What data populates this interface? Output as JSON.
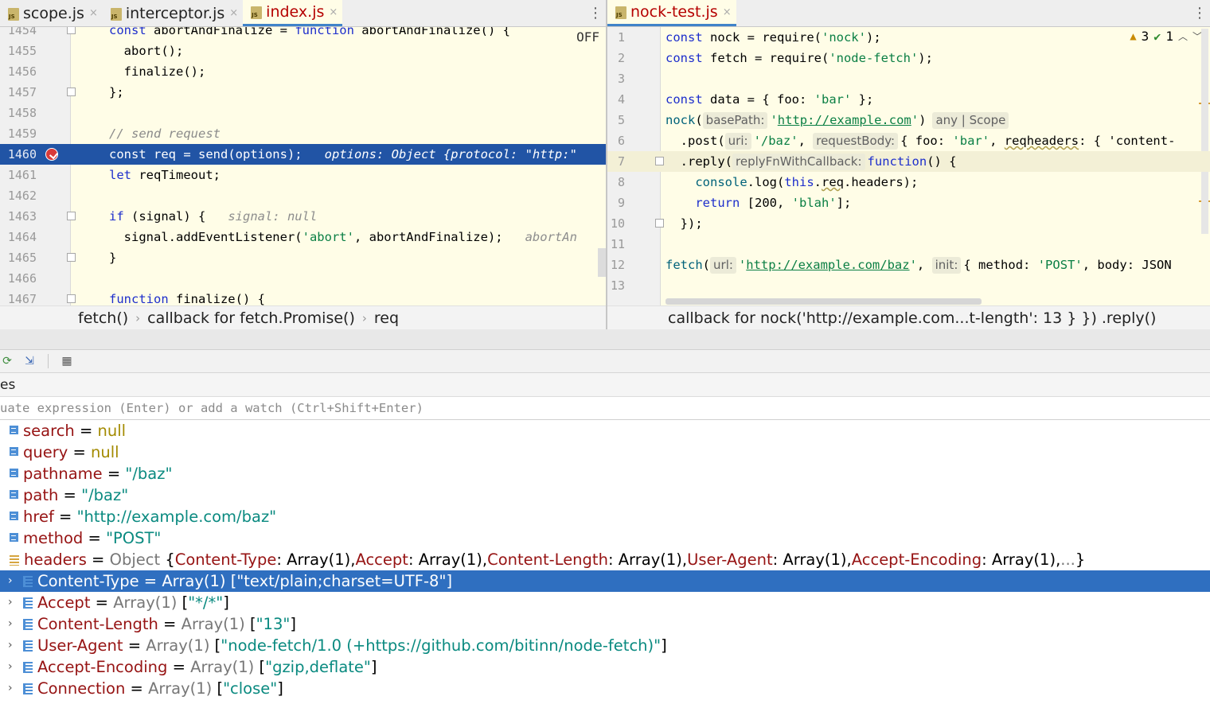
{
  "left_tabs": [
    {
      "name": "scope.js",
      "active": false
    },
    {
      "name": "interceptor.js",
      "active": false
    },
    {
      "name": "index.js",
      "active": true
    }
  ],
  "right_tabs": [
    {
      "name": "nock-test.js",
      "active": true
    }
  ],
  "more_glyph": "⋮",
  "close_glyph": "×",
  "left_editor": {
    "off_label": "OFF",
    "lines": [
      {
        "n": "1454",
        "code": "  const abortAndFinalize = function abortAndFinalize() {"
      },
      {
        "n": "1455",
        "code": "    abort();"
      },
      {
        "n": "1456",
        "code": "    finalize();"
      },
      {
        "n": "1457",
        "code": "  };"
      },
      {
        "n": "1458",
        "code": ""
      },
      {
        "n": "1459",
        "code": "  // send request"
      },
      {
        "n": "1460",
        "code": "  const req = send(options);",
        "inline": "options: Object {protocol: \"http:\"",
        "exec": true
      },
      {
        "n": "1461",
        "code": "  let reqTimeout;"
      },
      {
        "n": "1462",
        "code": ""
      },
      {
        "n": "1463",
        "code": "  if (signal) {",
        "inline": "signal: null"
      },
      {
        "n": "1464",
        "code": "    signal.addEventListener('abort', abortAndFinalize);",
        "inline": "abortAn"
      },
      {
        "n": "1465",
        "code": "  }"
      },
      {
        "n": "1466",
        "code": ""
      },
      {
        "n": "1467",
        "code": "  function finalize() {"
      }
    ]
  },
  "right_editor": {
    "inspection": {
      "warnings": "3",
      "ok": "1"
    },
    "lines": [
      {
        "n": "1",
        "code": "const nock = require('nock');"
      },
      {
        "n": "2",
        "code": "const fetch = require('node-fetch');"
      },
      {
        "n": "3",
        "code": ""
      },
      {
        "n": "4",
        "code": "const data = { foo: 'bar' };"
      },
      {
        "n": "5",
        "pre": "nock(",
        "hint1": "basePath:",
        "mid": "'http://example.com')",
        "hint2": "any | Scope"
      },
      {
        "n": "6",
        "pre": "  .post(",
        "hint1": "uri:",
        "mid": "'/baz', ",
        "hint2": "requestBody:",
        "post": "{ foo: 'bar', reqheaders: { 'content-"
      },
      {
        "n": "7",
        "pre": "  .reply(",
        "hint1": "replyFnWithCallback:",
        "mid": "function() {"
      },
      {
        "n": "8",
        "code": "    console.log(this.req.headers);"
      },
      {
        "n": "9",
        "code": "    return [200, 'blah'];"
      },
      {
        "n": "10",
        "code": "  });"
      },
      {
        "n": "11",
        "code": ""
      },
      {
        "n": "12",
        "pre": "fetch(",
        "hint1": "url:",
        "mid": "'http://example.com/baz', ",
        "hint2": "init:",
        "post": "{ method: 'POST', body: JSON"
      },
      {
        "n": "13",
        "code": ""
      }
    ]
  },
  "left_breadcrumbs": [
    "fetch()",
    "callback for fetch.Promise()",
    "req"
  ],
  "right_breadcrumbs": [
    "callback for nock('http://example.com...t-length': 13 } }) .reply()"
  ],
  "debugger": {
    "panel_title": "es",
    "eval_placeholder": "uate expression (Enter) or add a watch (Ctrl+Shift+Enter)",
    "variables": [
      {
        "name": "search",
        "eq": " = ",
        "value": "null",
        "kind": "null"
      },
      {
        "name": "query",
        "eq": " = ",
        "value": "null",
        "kind": "null"
      },
      {
        "name": "pathname",
        "eq": " = ",
        "value": "\"/baz\"",
        "kind": "str"
      },
      {
        "name": "path",
        "eq": " = ",
        "value": "\"/baz\"",
        "kind": "str"
      },
      {
        "name": "href",
        "eq": " = ",
        "value": "\"http://example.com/baz\"",
        "kind": "str"
      },
      {
        "name": "method",
        "eq": " = ",
        "value": "\"POST\"",
        "kind": "str"
      }
    ],
    "headers_row": {
      "name": "headers",
      "eq": " = ",
      "type": "Object",
      "summary": [
        {
          "k": "Content-Type",
          "v": "Array(1)"
        },
        {
          "k": "Accept",
          "v": "Array(1)"
        },
        {
          "k": "Content-Length",
          "v": "Array(1)"
        },
        {
          "k": "User-Agent",
          "v": "Array(1)"
        },
        {
          "k": "Accept-Encoding",
          "v": "Array(1)"
        }
      ],
      "ellipsis": "...",
      "open_brace": " {",
      "close_brace": "}"
    },
    "children": [
      {
        "name": "Content-Type",
        "type": "Array(1)",
        "value": "\"text/plain;charset=UTF-8\"",
        "selected": true
      },
      {
        "name": "Accept",
        "type": "Array(1)",
        "value": "\"*/*\"",
        "selected": false
      },
      {
        "name": "Content-Length",
        "type": "Array(1)",
        "value": "\"13\"",
        "selected": false
      },
      {
        "name": "User-Agent",
        "type": "Array(1)",
        "value": "\"node-fetch/1.0 (+https://github.com/bitinn/node-fetch)\"",
        "selected": false
      },
      {
        "name": "Accept-Encoding",
        "type": "Array(1)",
        "value": "\"gzip,deflate\"",
        "selected": false
      },
      {
        "name": "Connection",
        "type": "Array(1)",
        "value": "\"close\"",
        "selected": false
      }
    ]
  }
}
